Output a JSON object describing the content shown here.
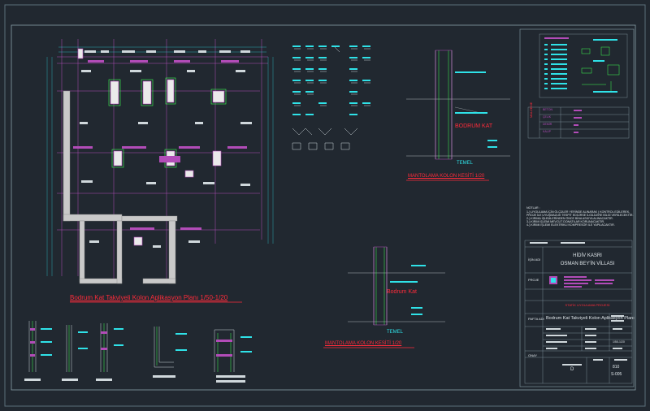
{
  "drawing": {
    "plan_title": "Bodrum Kat Takviyeli Kolon Aplikasyon Planı  1/50-1/20",
    "section_title_1": "MANTOLAMA KOLON KESİTİ  1/20",
    "section_title_2": "MANTOLAMA KOLON KESİTİ  1/20",
    "bodrum_label_1": "BODRUM KAT",
    "bodrum_label_2": "Bodrum Kat",
    "temel_label_1": "TEMEL",
    "temel_label_2": "TEMEL"
  },
  "notes": {
    "heading": "NOTLAR :",
    "lines": [
      "1-) UYGULAMA İÇİN ÖLÇÜLER YERİNDE ALINARAK ) KONTROL EDİLEREK,",
      "PROJE İLE UYUŞMAZLIK TESPİT EDİLİRSE İLGİLİLERE BİLGİ VERİLECEKTİR.",
      "2-) KIRIMA İŞLEMLERİNDEN ÖNCE BİNA ASKIYA ALINACAKTIR.",
      "3-) KIRIM İŞLEMİ MEVCUT DONATILAR KORUNACAKTIR.",
      "4-) KIRIMI İŞLEMİ ELEKTRİKLİ KOMPRESÖR İLE YAPILACAKTIR."
    ]
  },
  "title_block": {
    "job_label": "İŞİN ADI",
    "job_name_1": "HİDİV KASRI",
    "job_name_2": "OSMAN BEY'İN VİLLASI",
    "project_label": "PROJE",
    "project_stamp": "STATİK UYGULAMA PROJESİ",
    "sheet_label": "PAFTA ADI",
    "sheet_name": "Bodrum Kat Takviyeli Kolon Aplikasyon Planı",
    "scale": "1/50-1/20",
    "onay": "ONAY",
    "sheet_code_letter": "D",
    "sheet_number": "810",
    "sheet_code": "S-005"
  },
  "legend": {
    "table_label": "MALZEME",
    "rows": [
      "BETON",
      "ÇELİK",
      "DEMİR",
      "KALIP"
    ]
  }
}
